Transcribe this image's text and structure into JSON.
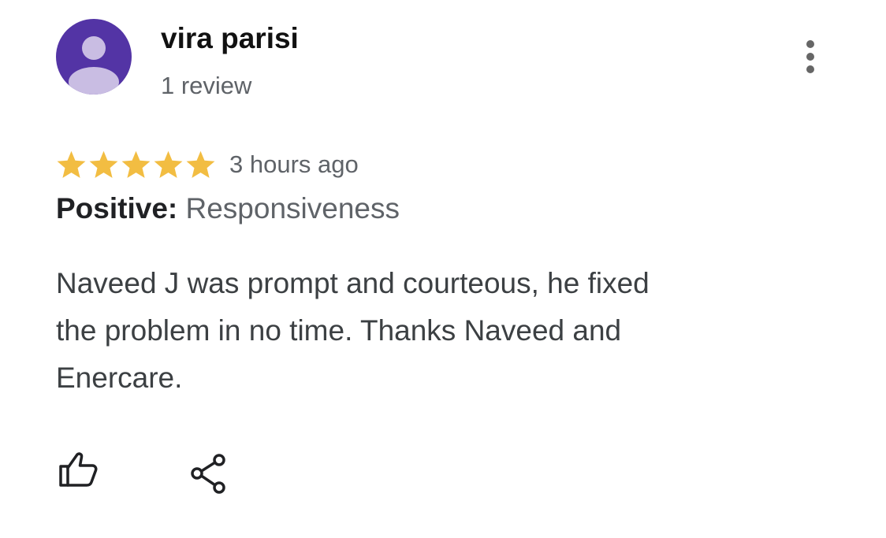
{
  "review": {
    "reviewer_name": "vira parisi",
    "review_count": "1 review",
    "rating": 5,
    "rating_max": 5,
    "time_ago": "3 hours ago",
    "attribute_label": "Positive:",
    "attribute_value": "Responsiveness",
    "body_lines": [
      "Naveed J was prompt and courteous, he fixed",
      "the problem in no time. Thanks Naveed and",
      "Enercare."
    ]
  },
  "icons": {
    "avatar": "default-person-avatar",
    "menu": "more-vertical-icon",
    "like": "thumbs-up-icon",
    "share": "share-icon",
    "star": "star-icon"
  },
  "colors": {
    "avatar_bg": "#5334a5",
    "avatar_fg": "#c9bde3",
    "star": "#f2bd42",
    "muted_text": "#5f6368",
    "icon": "#202124"
  }
}
